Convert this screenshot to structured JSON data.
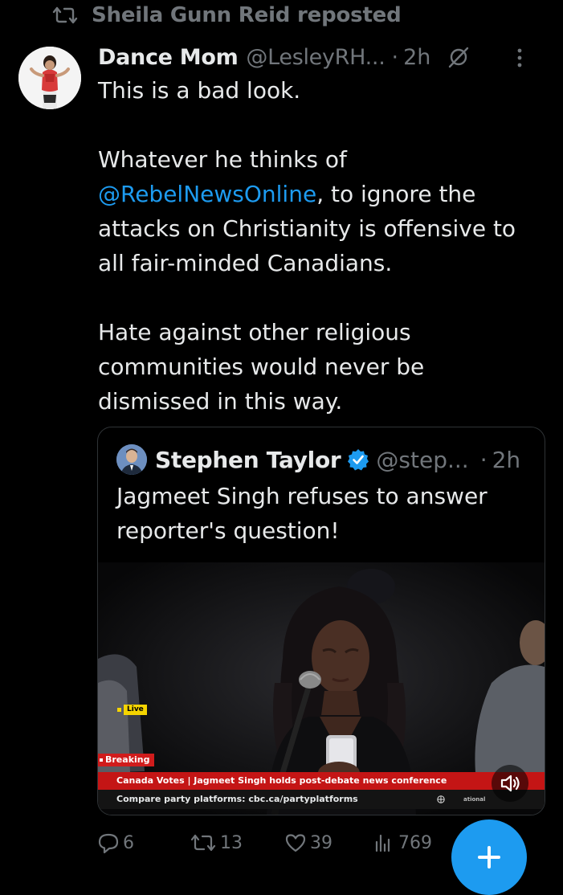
{
  "repost": {
    "text": "Sheila Gunn Reid reposted"
  },
  "tweet": {
    "author_name": "Dance Mom",
    "author_handle": "@LesleyRH...",
    "separator": "·",
    "time": "2h",
    "text_lines": [
      "This is a bad look.",
      "",
      "Whatever he thinks of"
    ],
    "mention": "@RebelNewsOnline",
    "text_after_mention": ", to ignore the\nattacks on Christianity is offensive to\nall fair-minded Canadians.\n\nHate against other religious\ncommunities would never be\ndismissed in this way."
  },
  "quote": {
    "author_name": "Stephen Taylor",
    "author_handle": "@step...",
    "separator": "·",
    "time": "2h",
    "text": "Jagmeet Singh refuses to answer reporter's question!",
    "video": {
      "live_label": "Live",
      "breaking_label": "Breaking",
      "ticker_line1": "Canada Votes | Jagmeet Singh holds post-debate news conference",
      "ticker_line2": "Compare party platforms: cbc.ca/partyplatforms",
      "ticker_side": "ational"
    }
  },
  "actions": {
    "replies": "6",
    "reposts": "13",
    "likes": "39",
    "views": "769"
  },
  "colors": {
    "background": "#000000",
    "text": "#e7e9ea",
    "muted": "#71767b",
    "accent": "#1d9bf0",
    "border": "#2f3336"
  },
  "icons": [
    "repost-icon",
    "grok-icon",
    "more-icon",
    "verified-icon",
    "mute-icon",
    "reply-icon",
    "like-icon",
    "views-icon",
    "compose-plus-icon"
  ]
}
